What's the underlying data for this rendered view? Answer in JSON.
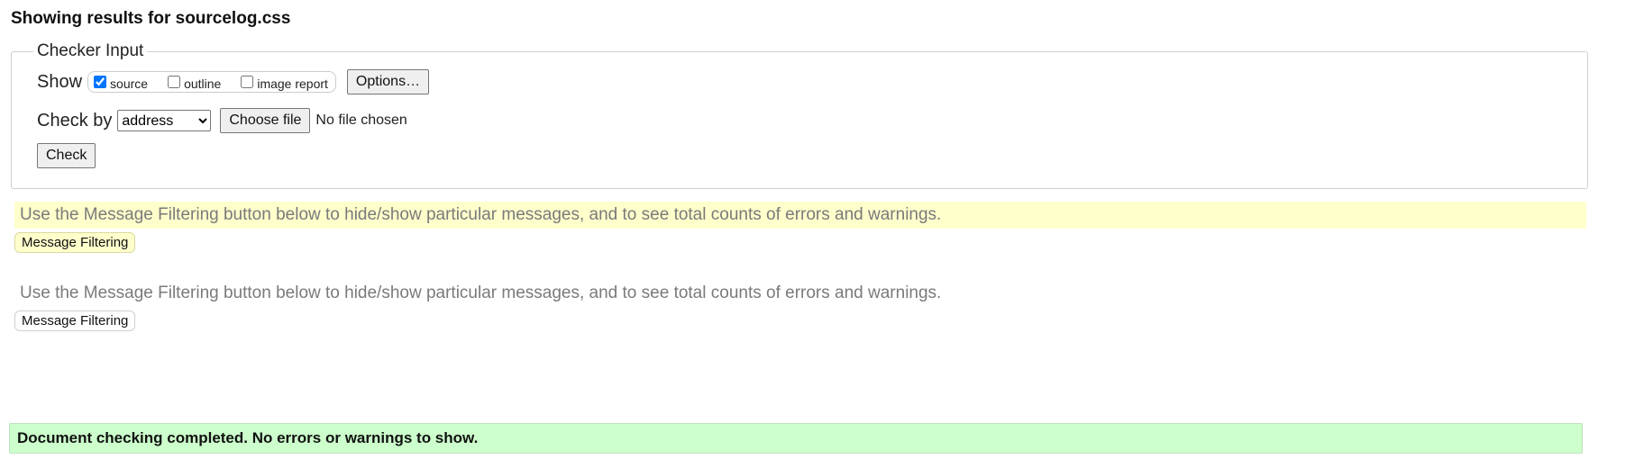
{
  "heading": "Showing results for sourcelog.css",
  "checker": {
    "legend": "Checker Input",
    "show_label": "Show",
    "checkboxes": [
      {
        "label": "source",
        "checked": true
      },
      {
        "label": "outline",
        "checked": false
      },
      {
        "label": "image report",
        "checked": false
      }
    ],
    "options_button": "Options…",
    "check_by_label": "Check by",
    "check_by_selected": "address",
    "choose_file_button": "Choose file",
    "no_file_text": "No file chosen",
    "check_button": "Check"
  },
  "filters": [
    {
      "text": "Use the Message Filtering button below to hide/show particular messages, and to see total counts of errors and warnings.",
      "button": "Message Filtering",
      "highlight": true
    },
    {
      "text": "Use the Message Filtering button below to hide/show particular messages, and to see total counts of errors and warnings.",
      "button": "Message Filtering",
      "highlight": false
    }
  ],
  "status": {
    "text": "Document checking completed. No errors or warnings to show.",
    "color": "#ccffcc"
  },
  "colors": {
    "highlight_yellow": "#ffffcc",
    "success_green": "#ccffcc"
  }
}
